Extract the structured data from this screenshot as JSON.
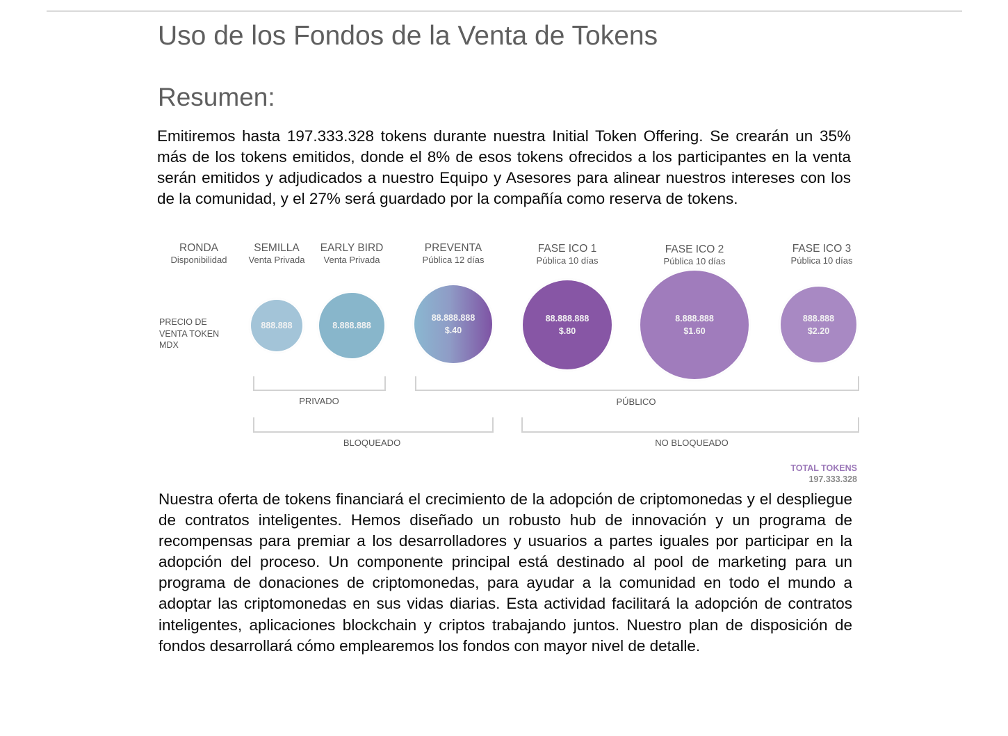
{
  "document": {
    "title": "Uso de los Fondos de la Venta de Tokens",
    "section_heading": "Resumen:",
    "paragraph_1": "Emitiremos hasta 197.333.328 tokens durante nuestra Initial Token Offering. Se crearán un 35% más de los tokens emitidos, donde el 8% de esos tokens ofrecidos a los participantes en la venta serán emitidos y adjudicados a nuestro Equipo y Asesores para alinear nuestros intereses con los de la comunidad, y el 27% será guardado por la compañía como reserva de tokens.",
    "paragraph_2": "Nuestra oferta de tokens financiará el crecimiento de la adopción de criptomonedas y el despliegue de contratos inteligentes. Hemos diseñado un robusto hub de innovación y un programa de recompensas para premiar a los desarrolladores y usuarios a partes iguales por participar en la adopción del proceso. Un componente principal está destinado al pool de marketing para un programa de donaciones de criptomonedas, para ayudar a la comunidad en todo el mundo a adoptar las criptomonedas en sus vidas diarias. Esta actividad facilitará la adopción de contratos inteligentes, aplicaciones blockchain y criptos trabajando juntos. Nuestro plan de disposición de fondos desarrollará cómo emplearemos los fondos con mayor nivel de detalle."
  },
  "infographic": {
    "header": {
      "title": "RONDA",
      "subtitle": "Disponibilidad"
    },
    "row_label": "PRECIO DE\nVENTA TOKEN\nMDX",
    "rounds": [
      {
        "title": "SEMILLA",
        "subtitle": "Venta Privada",
        "tokens": "888.888",
        "price": ""
      },
      {
        "title": "EARLY BIRD",
        "subtitle": "Venta Privada",
        "tokens": "8.888.888",
        "price": ""
      },
      {
        "title": "PREVENTA",
        "subtitle": "Pública 12 días",
        "tokens": "88.888.888",
        "price": "$.40"
      },
      {
        "title": "FASE ICO 1",
        "subtitle": "Pública 10 días",
        "tokens": "88.888.888",
        "price": "$.80"
      },
      {
        "title": "FASE ICO 2",
        "subtitle": "Pública 10 días",
        "tokens": "8.888.888",
        "price": "$1.60"
      },
      {
        "title": "FASE ICO 3",
        "subtitle": "Pública 10 días",
        "tokens": "888.888",
        "price": "$2.20"
      }
    ],
    "groups": {
      "privado": "PRIVADO",
      "publico": "PÚBLICO",
      "bloqueado": "BLOQUEADO",
      "no_bloqueado": "NO BLOQUEADO"
    },
    "total": {
      "label": "TOTAL TOKENS",
      "value": "197.333.328"
    },
    "colors": {
      "semilla": "#a3c4d8",
      "early_bird": "#88b6cb",
      "preventa_start": "#8ab8d1",
      "preventa_end": "#7e53a4",
      "ico1": "#8756a5",
      "ico2": "#a07cbc",
      "ico3": "#a889c3",
      "total_label": "#9b77b8"
    }
  }
}
